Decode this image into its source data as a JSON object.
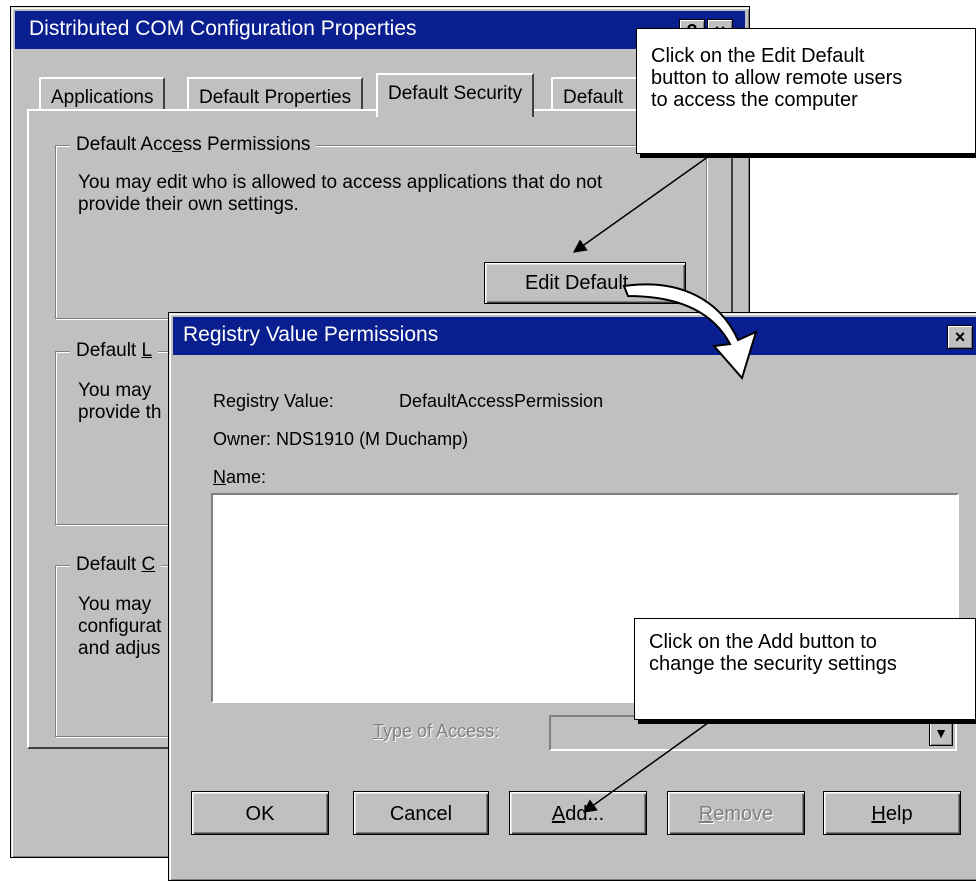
{
  "back_window": {
    "title": "Distributed COM Configuration Properties",
    "help_btn": "?",
    "close_btn": "×",
    "tabs": [
      {
        "label": "Applications"
      },
      {
        "label": "Default Properties"
      },
      {
        "label": "Default Security"
      },
      {
        "label": "Default"
      }
    ],
    "group1": {
      "legend_a": "Default Acc",
      "legend_u": "e",
      "legend_b": "ss Permissions",
      "line1": "You may edit who is allowed to access applications that do not",
      "line2": "provide their own settings.",
      "button": "Edit Default..."
    },
    "group2": {
      "legend_a": "Default ",
      "legend_u": "L",
      "line1": "You may",
      "line2": "provide th"
    },
    "group3": {
      "legend_a": "Default ",
      "legend_u": "C",
      "line1": "You may",
      "line2": "configurat",
      "line3": "and adjus"
    }
  },
  "callout_top": {
    "line1": "Click on the Edit Default",
    "line2": "button to allow remote users",
    "line3": "to access the computer"
  },
  "dialog": {
    "title": "Registry Value Permissions",
    "close_btn": "×",
    "registry_label": "Registry Value:",
    "registry_value": "DefaultAccessPermission",
    "owner": "Owner:  NDS1910 (M Duchamp)",
    "name_label_u": "N",
    "name_label_rest": "ame:",
    "type_label_u": "T",
    "type_label_rest": "ype of Access:",
    "buttons": {
      "ok": "OK",
      "cancel": "Cancel",
      "add_u": "A",
      "add_rest": "dd...",
      "remove_u": "R",
      "remove_rest": "emove",
      "help_u": "H",
      "help_rest": "elp"
    }
  },
  "callout_bottom": {
    "line1": "Click on the Add button to",
    "line2": "change the security settings"
  }
}
